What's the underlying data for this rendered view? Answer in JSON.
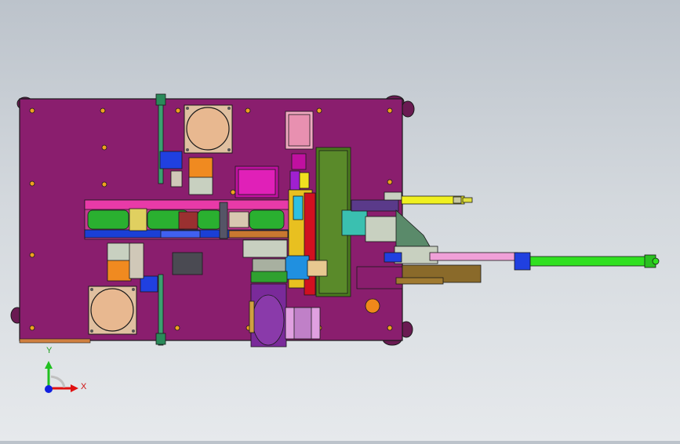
{
  "viewport": {
    "background_top": "#bcc3cb",
    "background_bottom": "#e6e9ec"
  },
  "model": {
    "plate_color": "#8a1e6e",
    "rail_color": "#1a3fd6",
    "frame_green": "#3a7a1e",
    "cylinder_yellow": "#f0f020",
    "cylinder_green": "#30e020",
    "rod_pink": "#f0a0d8",
    "motor_purple": "#7a2a9a",
    "pad_tan": "#e8b890",
    "block_orange": "#f08a20",
    "edge_color": "#1a1a1a"
  },
  "triad": {
    "y_label": "Y",
    "x_label": "X",
    "y_color": "#20c020",
    "x_color": "#e01010",
    "z_color": "#1020e0"
  }
}
